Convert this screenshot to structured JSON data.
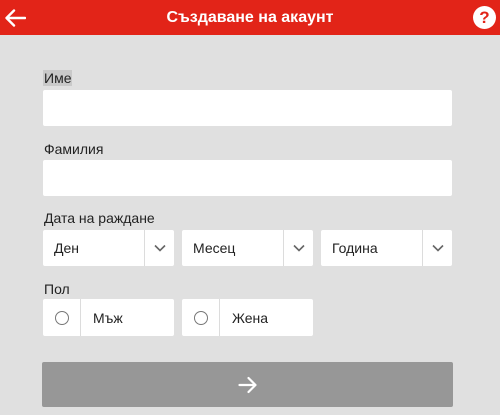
{
  "header": {
    "title": "Създаване на акаунт",
    "back_icon": "arrow-left-icon",
    "help_label": "?",
    "color": "#e22418"
  },
  "form": {
    "first_name": {
      "label": "Име",
      "value": ""
    },
    "last_name": {
      "label": "Фамилия",
      "value": ""
    },
    "birthdate": {
      "label": "Дата на раждане",
      "day": "Ден",
      "month": "Месец",
      "year": "Година"
    },
    "gender": {
      "label": "Пол",
      "male": "Мъж",
      "female": "Жена"
    },
    "submit_icon": "arrow-right-icon"
  }
}
